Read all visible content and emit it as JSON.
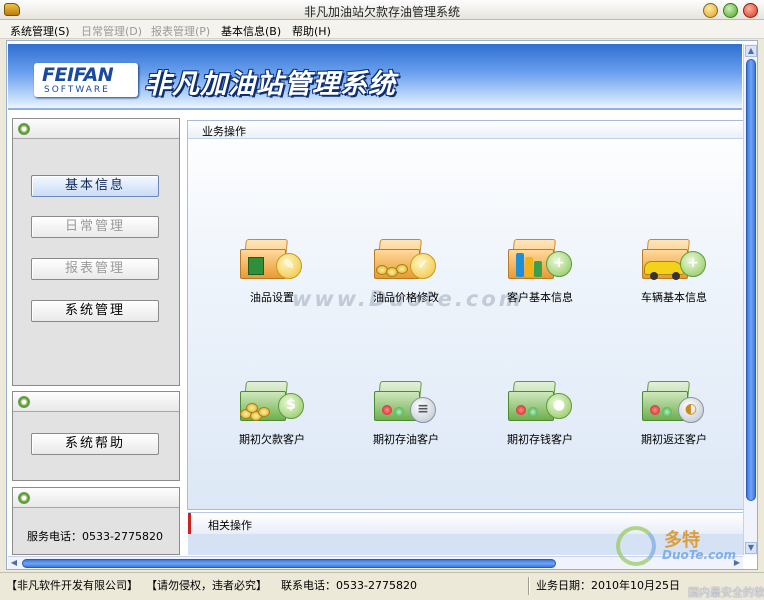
{
  "window": {
    "title": "非凡加油站欠款存油管理系统"
  },
  "menu": [
    {
      "label": "系统管理(S)",
      "enabled": true
    },
    {
      "label": "日常管理(D)",
      "enabled": false
    },
    {
      "label": "报表管理(P)",
      "enabled": false
    },
    {
      "label": "基本信息(B)",
      "enabled": true
    },
    {
      "label": "帮助(H)",
      "enabled": true
    }
  ],
  "banner": {
    "logo_text": "FEIFAN",
    "logo_sub": "SOFTWARE",
    "title": "非凡加油站管理系统"
  },
  "nav": {
    "buttons": [
      {
        "label": "基本信息",
        "state": "active"
      },
      {
        "label": "日常管理",
        "state": "disabled"
      },
      {
        "label": "报表管理",
        "state": "disabled"
      },
      {
        "label": "系统管理",
        "state": "normal"
      }
    ],
    "help_button": "系统帮助",
    "service_phone": "服务电话：0533-2775820"
  },
  "business": {
    "header": "业务操作",
    "items": [
      {
        "label": "油品设置",
        "icon": "oil-product-icon"
      },
      {
        "label": "油品价格修改",
        "icon": "oil-price-icon"
      },
      {
        "label": "客户基本信息",
        "icon": "customer-info-icon"
      },
      {
        "label": "车辆基本信息",
        "icon": "vehicle-info-icon"
      },
      {
        "label": "期初欠款客户",
        "icon": "opening-debt-icon"
      },
      {
        "label": "期初存油客户",
        "icon": "opening-oil-deposit-icon"
      },
      {
        "label": "期初存钱客户",
        "icon": "opening-money-deposit-icon"
      },
      {
        "label": "期初返还客户",
        "icon": "opening-refund-icon"
      }
    ],
    "watermark": "www.Duote.com"
  },
  "related": {
    "header": "相关操作"
  },
  "watermark_logo": {
    "line1": "多特",
    "line2": "DuoTe.com"
  },
  "status": {
    "company": "【非凡软件开发有限公司】",
    "notice": "【请勿侵权，违者必究】",
    "phone": "联系电话：0533-2775820",
    "date": "业务日期：2010年10月25日",
    "tail": "国内最安全的软件站"
  },
  "colors": {
    "banner": "#2f6fd0",
    "scroll_thumb": "#3d78dc",
    "active_button": "#c9dcf7"
  }
}
